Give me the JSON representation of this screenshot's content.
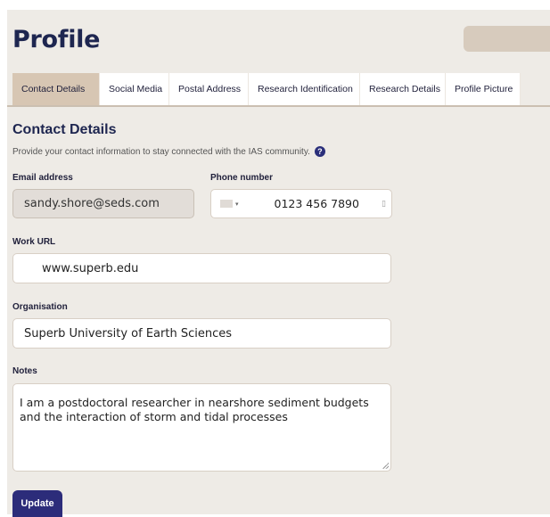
{
  "page": {
    "title": "Profile"
  },
  "tabs": [
    {
      "label": "Contact Details",
      "active": true
    },
    {
      "label": "Social Media",
      "active": false
    },
    {
      "label": "Postal Address",
      "active": false
    },
    {
      "label": "Research Identification",
      "active": false
    },
    {
      "label": "Research Details",
      "active": false
    },
    {
      "label": "Profile Picture",
      "active": false
    }
  ],
  "section": {
    "title": "Contact Details",
    "description": "Provide your contact information to stay connected with the IAS community.",
    "help_icon": "?"
  },
  "form": {
    "email": {
      "label": "Email address",
      "value": "sandy.shore@seds.com"
    },
    "phone": {
      "label": "Phone number",
      "country_caret": "▾",
      "value": "0123 456 7890",
      "icon": "phone-icon"
    },
    "work_url": {
      "label": "Work URL",
      "value": "www.superb.edu"
    },
    "organisation": {
      "label": "Organisation",
      "value": "Superb University of Earth Sciences"
    },
    "notes": {
      "label": "Notes",
      "value": "I am a postdoctoral researcher in nearshore sediment budgets and the interaction of storm and tidal processes"
    },
    "update_label": "Update"
  },
  "colors": {
    "accent": "#2c2c7a",
    "active_tab": "#d7c6b3",
    "background": "#eeebe6"
  }
}
